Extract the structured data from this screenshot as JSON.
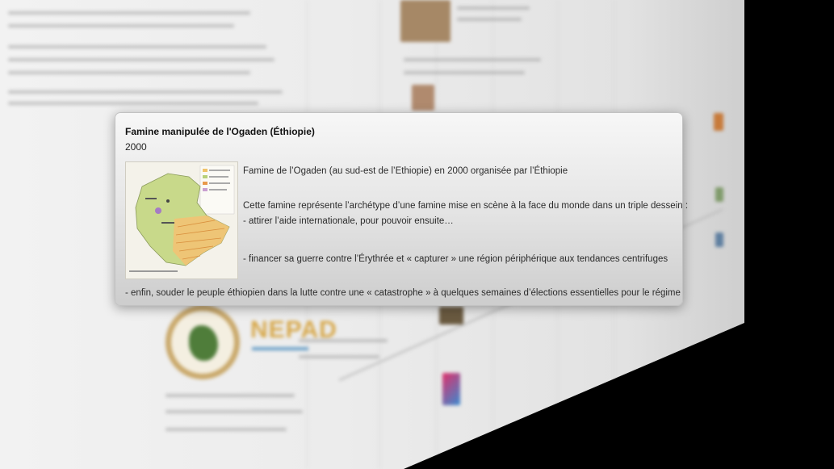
{
  "popup": {
    "title": "Famine manipulée de l'Ogaden (Éthiopie)",
    "year": "2000",
    "image_icon": "ethiopia-map-image",
    "lines": [
      "Famine de l’Ogaden (au sud-est de l’Ethiopie) en 2000 organisée par l’Éthiopie",
      "Cette famine représente l’archétype d’une famine mise en scène à la face du monde dans un triple dessein :",
      "- attirer l’aide internationale, pour pouvoir ensuite…",
      "- financer sa guerre contre l’Érythrée et « capturer » une région périphérique aux tendances centrifuges",
      "- enfin, souder le peuple éthiopien dans la lutte contre une « catastrophe » à quelques semaines d’élections essentielles pour le régime"
    ]
  },
  "background": {
    "logo_text": "NEPAD"
  },
  "colors": {
    "popup_bg": "#e7e7e7",
    "page_bg": "#eeeeee",
    "backdrop": "#000000"
  }
}
